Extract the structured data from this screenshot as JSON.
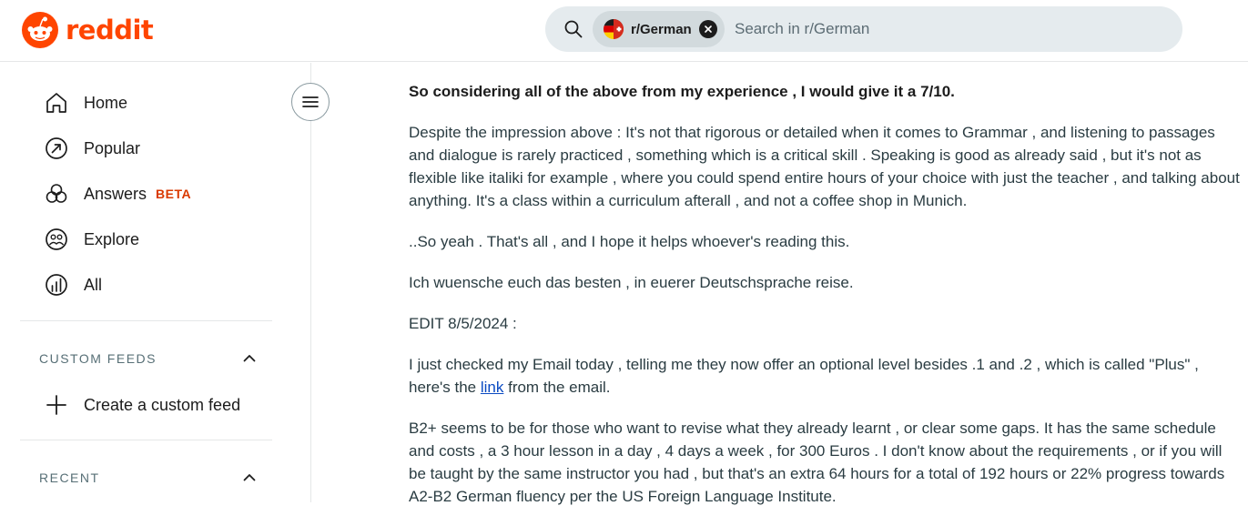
{
  "header": {
    "brand": "reddit",
    "search": {
      "community_chip": "r/German",
      "placeholder": "Search in r/German"
    }
  },
  "sidebar": {
    "nav": [
      {
        "label": "Home",
        "icon": "home-icon"
      },
      {
        "label": "Popular",
        "icon": "popular-icon"
      },
      {
        "label": "Answers",
        "icon": "answers-icon",
        "badge": "BETA"
      },
      {
        "label": "Explore",
        "icon": "explore-icon"
      },
      {
        "label": "All",
        "icon": "all-icon"
      }
    ],
    "custom_feeds": {
      "title": "CUSTOM FEEDS",
      "create_label": "Create a custom feed"
    },
    "recent": {
      "title": "RECENT"
    }
  },
  "post": {
    "p1": "So considering all of the above from my experience , I would give it a 7/10.",
    "p2": "Despite the impression above : It's not that rigorous or detailed when it comes to Grammar , and listening to passages and dialogue is rarely practiced , something which is a critical skill . Speaking is good as already said , but it's not as flexible like italiki for example , where you could spend entire hours of your choice with just the teacher , and talking about anything. It's a class within a curriculum afterall , and not a coffee shop in Munich.",
    "p3": "..So yeah . That's all , and I hope it helps whoever's reading this.",
    "p4": "Ich wuensche euch das besten , in euerer Deutschsprache reise.",
    "p5": "EDIT 8/5/2024 :",
    "p6_before": "I just checked my Email today , telling me they now offer an optional level besides .1 and .2 , which is called \"Plus\" , here's the ",
    "p6_link": "link",
    "p6_after": " from the email.",
    "p7": "B2+ seems to be for those who want to revise what they already learnt , or clear some gaps. It has the same schedule and costs , a 3 hour lesson in a day , 4 days a week , for 300 Euros . I don't know about the requirements , or if you will be taught by the same instructor you had , but that's an extra 64 hours for a total of 192 hours or 22% progress towards A2-B2 German fluency per the US Foreign Language Institute."
  },
  "colors": {
    "brand": "#ff4500",
    "beta": "#d93900",
    "link": "#0a4ac2"
  }
}
